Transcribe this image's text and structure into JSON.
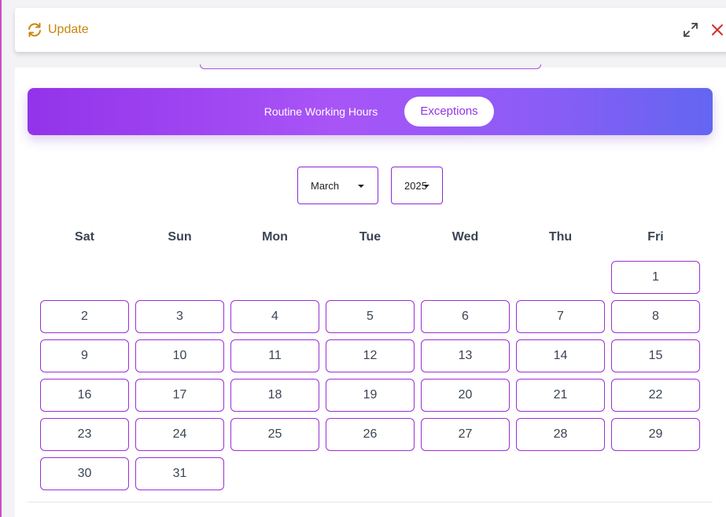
{
  "header": {
    "title": "Update",
    "title_color": "#c9860c",
    "icons": {
      "refresh": "refresh-icon",
      "expand": "expand-icon",
      "close": "close-icon"
    },
    "close_color": "#d32f2f"
  },
  "tabs": [
    {
      "label": "Routine Working Hours",
      "active": false
    },
    {
      "label": "Exceptions",
      "active": true
    }
  ],
  "filters": {
    "month": "March",
    "year": "2025"
  },
  "calendar": {
    "weekdays": [
      "Sat",
      "Sun",
      "Mon",
      "Tue",
      "Wed",
      "Thu",
      "Fri"
    ],
    "first_day_column": 6,
    "days": [
      "1",
      "2",
      "3",
      "4",
      "5",
      "6",
      "7",
      "8",
      "9",
      "10",
      "11",
      "12",
      "13",
      "14",
      "15",
      "16",
      "17",
      "18",
      "19",
      "20",
      "21",
      "22",
      "23",
      "24",
      "25",
      "26",
      "27",
      "28",
      "29",
      "30",
      "31"
    ]
  },
  "colors": {
    "accent": "#9333ea",
    "gradient_end": "#6366f1",
    "cell_border": "#9b2fd6"
  }
}
